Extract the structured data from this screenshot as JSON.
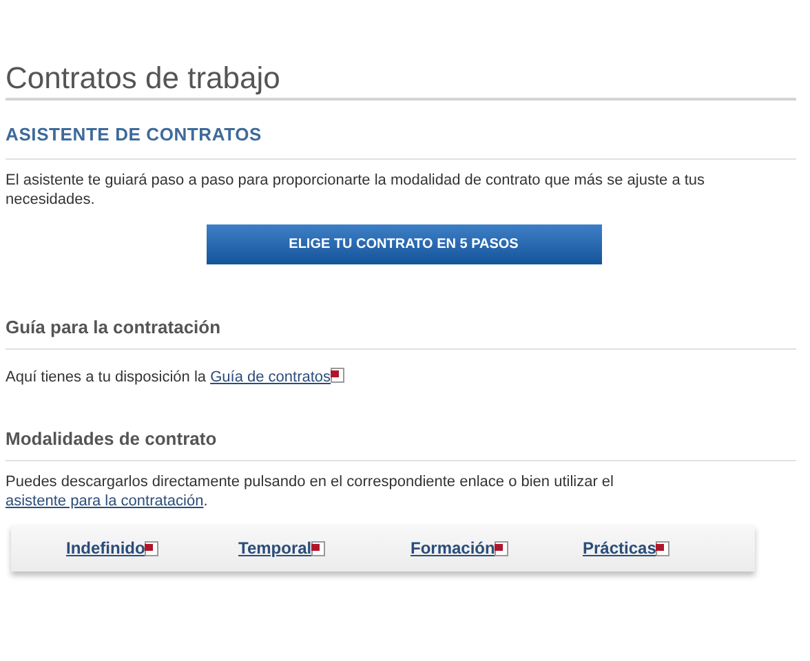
{
  "page_title": "Contratos de trabajo",
  "assistant": {
    "heading": "ASISTENTE DE CONTRATOS",
    "text": "El asistente te guiará paso a paso para proporcionarte la modalidad de contrato que más se ajuste a tus necesidades.",
    "button": "ELIGE TU CONTRATO EN 5 PASOS"
  },
  "guide": {
    "heading": "Guía para la contratación",
    "text": "Aquí tienes a tu disposición la",
    "link": "Guía de contratos"
  },
  "modalities": {
    "heading": "Modalidades de contrato",
    "text": "Puedes descargarlos directamente pulsando en el correspondiente enlace o bien utilizar el",
    "link": "asistente para la contratación",
    "link_after": ".",
    "contracts": [
      "Indefinido",
      "Temporal",
      "Formación",
      "Prácticas"
    ]
  }
}
